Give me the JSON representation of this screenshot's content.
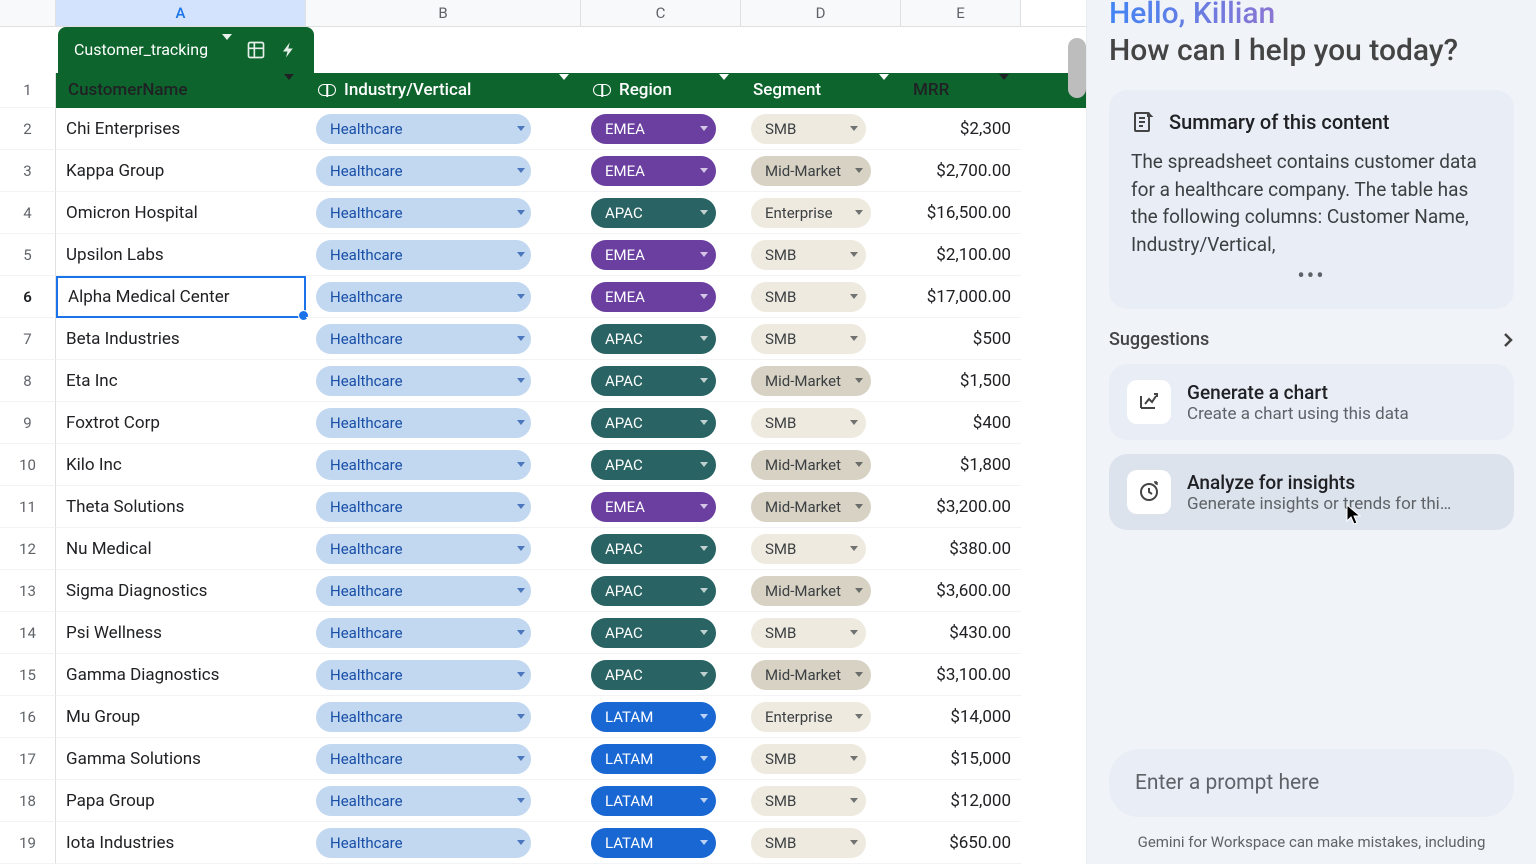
{
  "spreadsheet": {
    "tab_name": "Customer_tracking",
    "column_letters": [
      "A",
      "B",
      "C",
      "D",
      "E"
    ],
    "headers": [
      "CustomerName",
      "Industry/Vertical",
      "Region",
      "Segment",
      "MRR"
    ],
    "selected_cell": {
      "row": 6,
      "col": "A"
    },
    "rows": [
      {
        "n": 2,
        "name": "Chi Enterprises",
        "industry": "Healthcare",
        "region": "EMEA",
        "segment": "SMB",
        "mrr": "$2,300"
      },
      {
        "n": 3,
        "name": "Kappa Group",
        "industry": "Healthcare",
        "region": "EMEA",
        "segment": "Mid-Market",
        "mrr": "$2,700.00"
      },
      {
        "n": 4,
        "name": "Omicron Hospital",
        "industry": "Healthcare",
        "region": "APAC",
        "segment": "Enterprise",
        "mrr": "$16,500.00"
      },
      {
        "n": 5,
        "name": "Upsilon Labs",
        "industry": "Healthcare",
        "region": "EMEA",
        "segment": "SMB",
        "mrr": "$2,100.00"
      },
      {
        "n": 6,
        "name": "Alpha Medical Center",
        "industry": "Healthcare",
        "region": "EMEA",
        "segment": "SMB",
        "mrr": "$17,000.00"
      },
      {
        "n": 7,
        "name": "Beta Industries",
        "industry": "Healthcare",
        "region": "APAC",
        "segment": "SMB",
        "mrr": "$500"
      },
      {
        "n": 8,
        "name": "Eta Inc",
        "industry": "Healthcare",
        "region": "APAC",
        "segment": "Mid-Market",
        "mrr": "$1,500"
      },
      {
        "n": 9,
        "name": "Foxtrot Corp",
        "industry": "Healthcare",
        "region": "APAC",
        "segment": "SMB",
        "mrr": "$400"
      },
      {
        "n": 10,
        "name": "Kilo Inc",
        "industry": "Healthcare",
        "region": "APAC",
        "segment": "Mid-Market",
        "mrr": "$1,800"
      },
      {
        "n": 11,
        "name": "Theta Solutions",
        "industry": "Healthcare",
        "region": "EMEA",
        "segment": "Mid-Market",
        "mrr": "$3,200.00"
      },
      {
        "n": 12,
        "name": "Nu Medical",
        "industry": "Healthcare",
        "region": "APAC",
        "segment": "SMB",
        "mrr": "$380.00"
      },
      {
        "n": 13,
        "name": "Sigma Diagnostics",
        "industry": "Healthcare",
        "region": "APAC",
        "segment": "Mid-Market",
        "mrr": "$3,600.00"
      },
      {
        "n": 14,
        "name": "Psi Wellness",
        "industry": "Healthcare",
        "region": "APAC",
        "segment": "SMB",
        "mrr": "$430.00"
      },
      {
        "n": 15,
        "name": "Gamma Diagnostics",
        "industry": "Healthcare",
        "region": "APAC",
        "segment": "Mid-Market",
        "mrr": "$3,100.00"
      },
      {
        "n": 16,
        "name": "Mu Group",
        "industry": "Healthcare",
        "region": "LATAM",
        "segment": "Enterprise",
        "mrr": "$14,000"
      },
      {
        "n": 17,
        "name": "Gamma Solutions",
        "industry": "Healthcare",
        "region": "LATAM",
        "segment": "SMB",
        "mrr": "$15,000"
      },
      {
        "n": 18,
        "name": "Papa Group",
        "industry": "Healthcare",
        "region": "LATAM",
        "segment": "SMB",
        "mrr": "$12,000"
      },
      {
        "n": 19,
        "name": "Iota Industries",
        "industry": "Healthcare",
        "region": "LATAM",
        "segment": "SMB",
        "mrr": "$650.00"
      }
    ]
  },
  "panel": {
    "hello": "Hello, Killian",
    "help": "How can I help you today?",
    "summary_title": "Summary of this content",
    "summary_body": "The spreadsheet contains customer data for a healthcare company. The table has the following columns: Customer Name, Industry/Vertical,",
    "suggestions_label": "Suggestions",
    "suggestions": [
      {
        "title": "Generate a chart",
        "sub": "Create a chart using this data"
      },
      {
        "title": "Analyze for insights",
        "sub": "Generate insights or trends for thi…"
      }
    ],
    "prompt_placeholder": "Enter a prompt here",
    "disclaimer": "Gemini for Workspace can make mistakes, including"
  },
  "colors": {
    "region": {
      "EMEA": "chip-emea",
      "APAC": "chip-apac",
      "LATAM": "chip-latam"
    },
    "segment": {
      "SMB": "chip-smb",
      "Mid-Market": "chip-mid",
      "Enterprise": "chip-ent"
    }
  }
}
